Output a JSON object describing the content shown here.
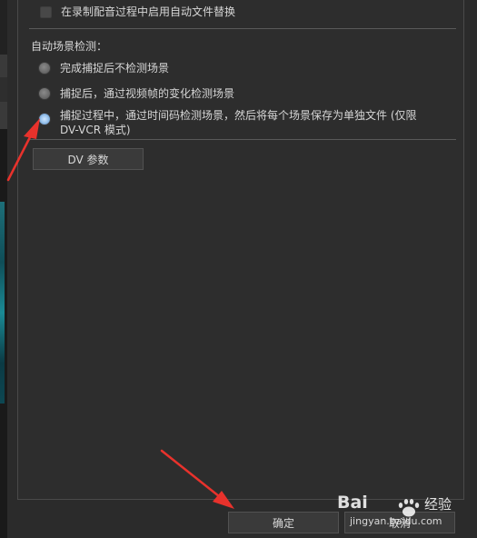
{
  "capture_options": {
    "auto_file_replace_label": "在录制配音过程中启用自动文件替换"
  },
  "scene_detection": {
    "heading": "自动场景检测：",
    "options": [
      {
        "label": "完成捕捉后不检测场景",
        "selected": false
      },
      {
        "label": "捕捉后，通过视频帧的变化检测场景",
        "selected": false
      },
      {
        "label_line1": "捕捉过程中，通过时间码检测场景，然后将每个场景保存为单独文件 (仅限",
        "label_line2": "DV-VCR 模式)",
        "selected": true
      }
    ]
  },
  "buttons": {
    "dv_params": "DV 参数",
    "ok": "确定",
    "cancel": "取消"
  },
  "watermark": {
    "brand": "Bai",
    "brand2": "经验",
    "url": "jingyan.baidu.com"
  },
  "colors": {
    "annotation_arrow": "#e8322c",
    "radio_selected": "#9ec7ef"
  }
}
